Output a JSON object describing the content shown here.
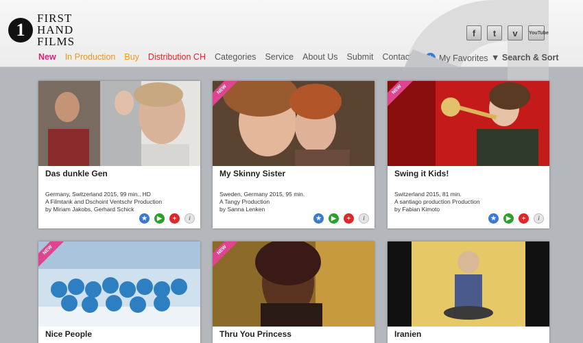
{
  "logo": {
    "numeral": "1",
    "line1": "FIRST",
    "line2": "HAND",
    "line3": "FILMS"
  },
  "nav": [
    {
      "label": "New",
      "color": "#d4237a",
      "bold": true
    },
    {
      "label": "In Production",
      "color": "#f0961e"
    },
    {
      "label": "Buy",
      "color": "#f0961e"
    },
    {
      "label": "Distribution CH",
      "color": "#e0262a"
    },
    {
      "label": "Categories",
      "color": "#555555"
    },
    {
      "label": "Service",
      "color": "#555555"
    },
    {
      "label": "About Us",
      "color": "#555555"
    },
    {
      "label": "Submit",
      "color": "#555555"
    },
    {
      "label": "Contact",
      "color": "#555555"
    }
  ],
  "social": [
    {
      "icon": "facebook-icon",
      "glyph": "f"
    },
    {
      "icon": "twitter-icon",
      "glyph": "t"
    },
    {
      "icon": "vimeo-icon",
      "glyph": "v"
    },
    {
      "icon": "youtube-icon",
      "glyph": "YouTube"
    }
  ],
  "favorites_label": "My Favorites",
  "search_sort_label": "Search & Sort",
  "new_badge": "NEW",
  "films": [
    {
      "title": "Das dunkle Gen",
      "is_new": false,
      "meta": [
        "Germany, Switzerland 2015, 99 min., HD",
        "A Filmtank and Dschoint Ventschr Production",
        "by Miriam Jakobs, Gerhard Schick"
      ]
    },
    {
      "title": "My Skinny Sister",
      "is_new": true,
      "meta": [
        "Sweden, Germany 2015, 95 min.",
        "A Tangy Production",
        "by Sanna Lenken"
      ]
    },
    {
      "title": "Swing it Kids!",
      "is_new": true,
      "meta": [
        "Switzerland 2015, 81 min.",
        "A santiago production Production",
        "by Fabian Kimoto"
      ]
    },
    {
      "title": "Nice People",
      "is_new": true,
      "meta": []
    },
    {
      "title": "Thru You Princess",
      "is_new": true,
      "meta": []
    },
    {
      "title": "Iranien",
      "is_new": false,
      "meta": []
    }
  ]
}
